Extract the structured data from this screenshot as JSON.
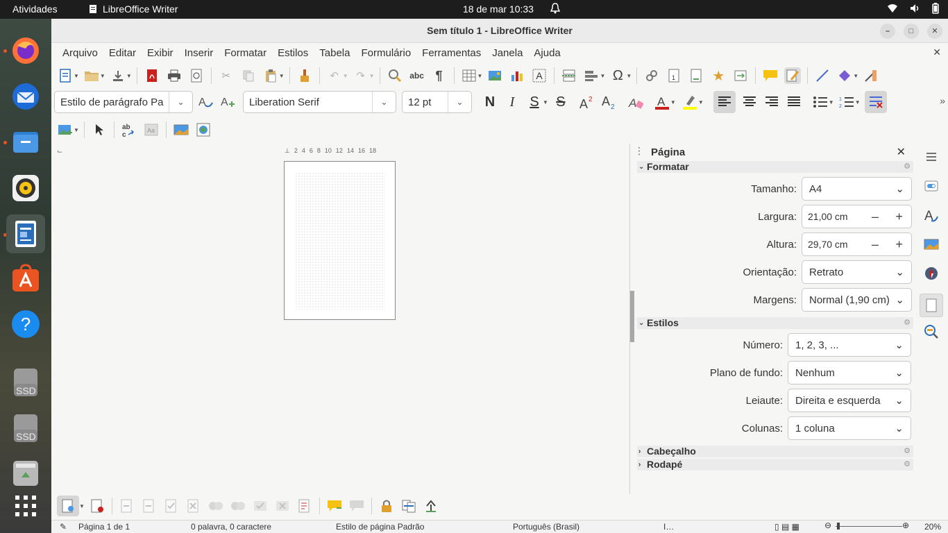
{
  "topbar": {
    "activities": "Atividades",
    "app_name": "LibreOffice Writer",
    "datetime": "18 de mar  10:33"
  },
  "dock": {
    "items": [
      "firefox-icon",
      "thunderbird-icon",
      "files-icon",
      "rhythmbox-icon",
      "libreoffice-writer-icon",
      "app-center-icon",
      "help-icon",
      "ssd-drive-icon",
      "ssd-drive-icon",
      "trash-icon",
      "show-apps-icon"
    ],
    "ssd_label": "SSD"
  },
  "window": {
    "title": "Sem título 1 - LibreOffice Writer"
  },
  "menu": [
    "Arquivo",
    "Editar",
    "Exibir",
    "Inserir",
    "Formatar",
    "Estilos",
    "Tabela",
    "Formulário",
    "Ferramentas",
    "Janela",
    "Ajuda"
  ],
  "format_toolbar": {
    "paragraph_style": "Estilo de parágrafo Pa",
    "font_name": "Liberation Serif",
    "font_size": "12 pt",
    "bold": "N",
    "italic": "I",
    "underline": "S",
    "strike": "S"
  },
  "ruler_ticks": [
    "2",
    "4",
    "6",
    "8",
    "10",
    "12",
    "14",
    "16",
    "18"
  ],
  "sidebar": {
    "title": "Página",
    "sections": {
      "format": "Formatar",
      "styles": "Estilos",
      "header": "Cabeçalho",
      "footer": "Rodapé"
    },
    "fields": {
      "size_label": "Tamanho:",
      "size_value": "A4",
      "width_label": "Largura:",
      "width_value": "21,00 cm",
      "height_label": "Altura:",
      "height_value": "29,70 cm",
      "orientation_label": "Orientação:",
      "orientation_value": "Retrato",
      "margins_label": "Margens:",
      "margins_value": "Normal (1,90 cm)",
      "number_label": "Número:",
      "number_value": "1, 2, 3, ...",
      "background_label": "Plano de fundo:",
      "background_value": "Nenhum",
      "layout_label": "Leiaute:",
      "layout_value": "Direita e esquerda",
      "columns_label": "Colunas:",
      "columns_value": "1 coluna"
    }
  },
  "status": {
    "page": "Página 1 de 1",
    "words": "0 palavra, 0 caractere",
    "page_style": "Estilo de página Padrão",
    "language": "Português (Brasil)",
    "zoom": "20%"
  },
  "colors": {
    "accent": "#e95420",
    "font_color": "#c9211e",
    "highlight": "#ffff00"
  }
}
